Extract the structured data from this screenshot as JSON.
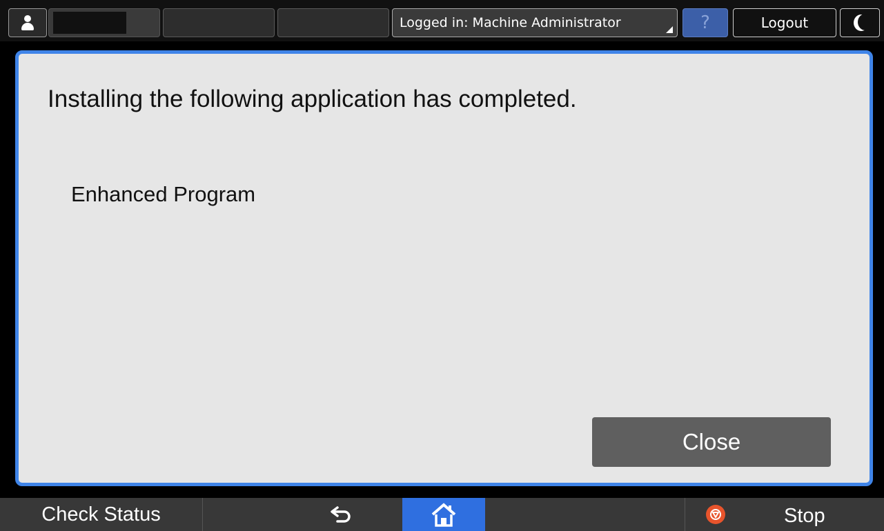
{
  "topbar": {
    "login_info": "Logged in: Machine Administrator",
    "help_label": "?",
    "logout_label": "Logout"
  },
  "dialog": {
    "message": "Installing the following application has completed.",
    "app_name": "Enhanced Program",
    "close_label": "Close"
  },
  "bottombar": {
    "check_status_label": "Check Status",
    "stop_label": "Stop"
  },
  "icons": {
    "user": "user-icon",
    "sleep": "moon-icon",
    "back": "back-arrow-icon",
    "home": "home-icon",
    "stop": "stop-icon"
  },
  "colors": {
    "dialog_border": "#3f84e8",
    "home_active": "#2f6fe0",
    "stop_accent": "#e8542c",
    "help_button": "#3c5fa8"
  }
}
